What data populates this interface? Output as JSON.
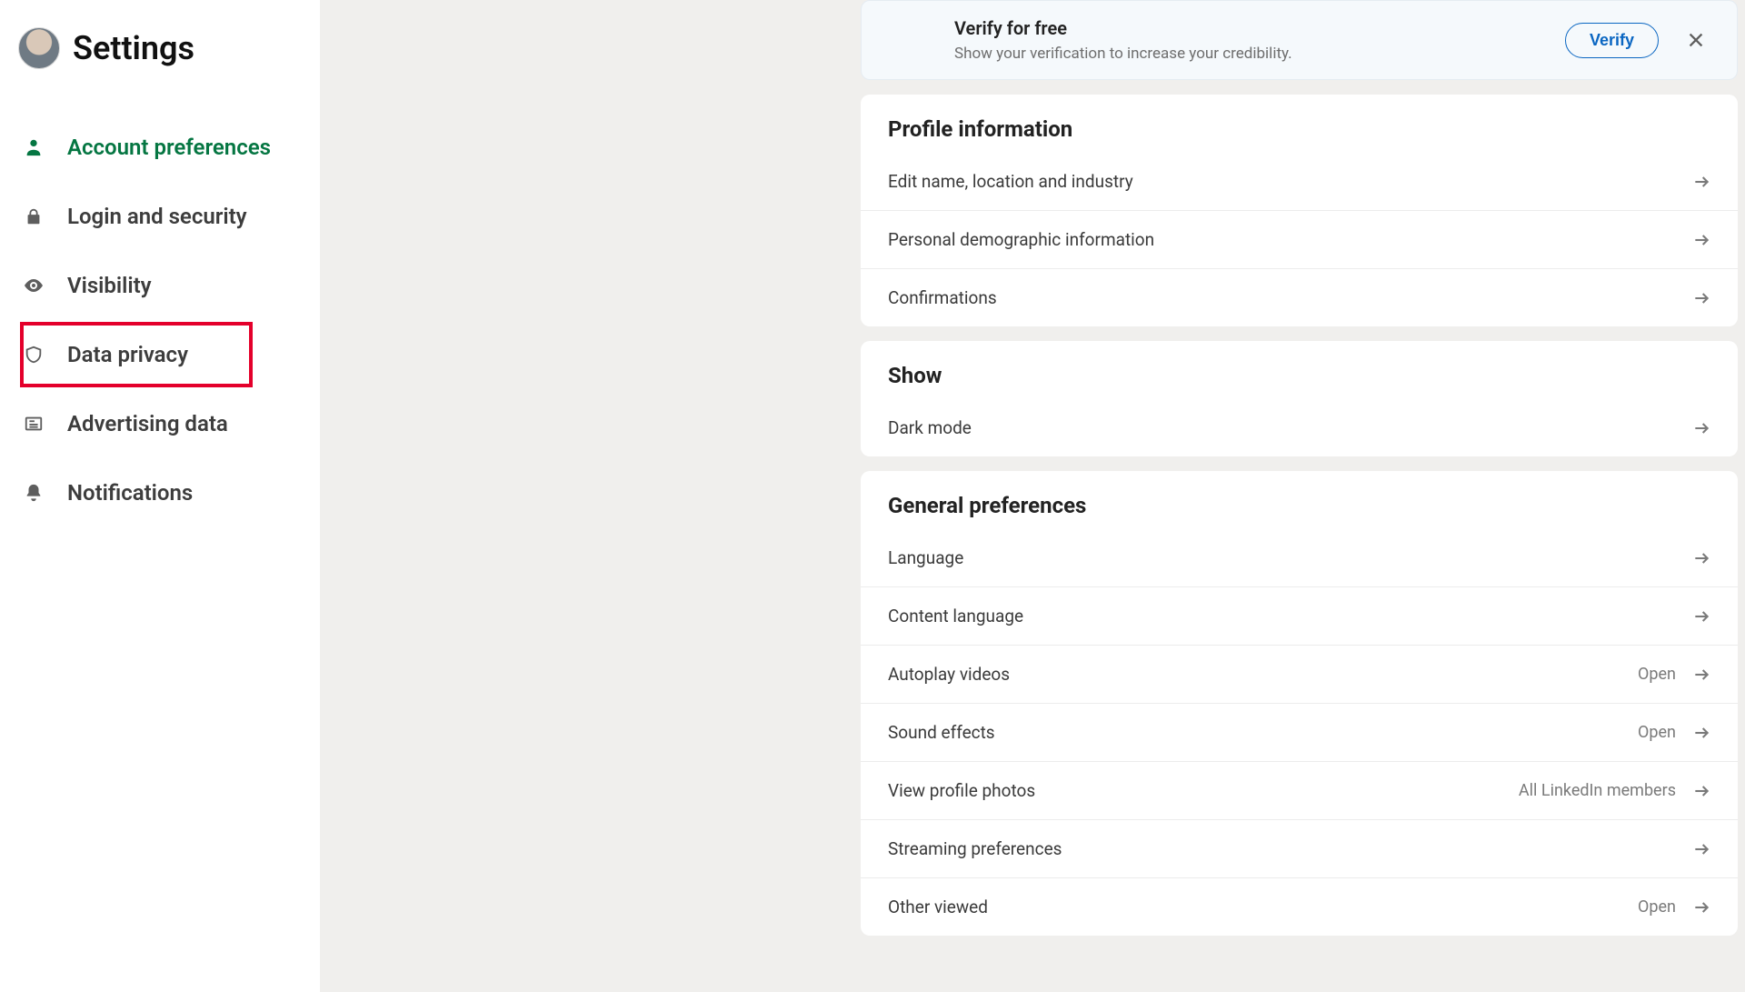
{
  "header": {
    "title": "Settings"
  },
  "nav": {
    "items": [
      {
        "label": "Account preferences"
      },
      {
        "label": "Login and security"
      },
      {
        "label": "Visibility"
      },
      {
        "label": "Data privacy"
      },
      {
        "label": "Advertising data"
      },
      {
        "label": "Notifications"
      }
    ]
  },
  "banner": {
    "title": "Verify for free",
    "subtitle": "Show your verification to increase your credibility.",
    "action": "Verify"
  },
  "sections": {
    "profile": {
      "title": "Profile information",
      "rows": [
        {
          "label": "Edit name, location and industry"
        },
        {
          "label": "Personal demographic information"
        },
        {
          "label": "Confirmations"
        }
      ]
    },
    "show": {
      "title": "Show",
      "rows": [
        {
          "label": "Dark mode"
        }
      ]
    },
    "general": {
      "title": "General preferences",
      "rows": [
        {
          "label": "Language",
          "value": ""
        },
        {
          "label": "Content language",
          "value": ""
        },
        {
          "label": "Autoplay videos",
          "value": "Open"
        },
        {
          "label": "Sound effects",
          "value": "Open"
        },
        {
          "label": "View profile photos",
          "value": "All LinkedIn members"
        },
        {
          "label": "Streaming preferences",
          "value": ""
        },
        {
          "label": "Other viewed",
          "value": "Open"
        }
      ]
    }
  }
}
